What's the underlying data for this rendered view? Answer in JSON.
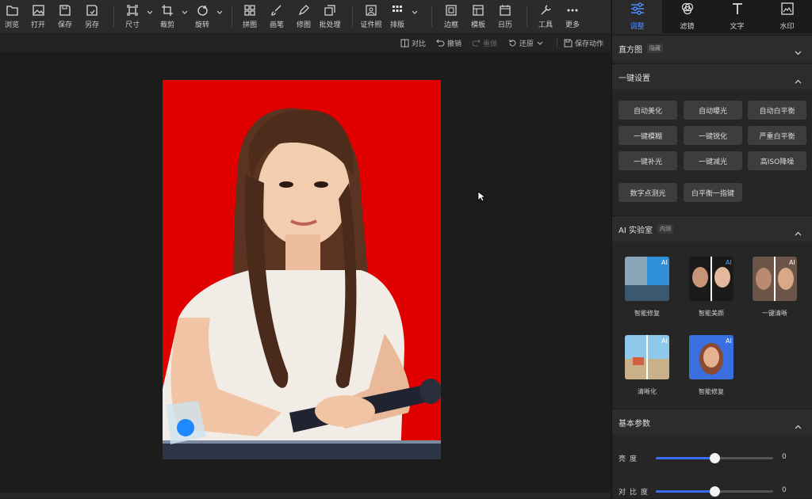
{
  "toolbar": {
    "new": "浏览",
    "open": "打开",
    "save": "保存",
    "save_as": "另存",
    "size": "尺寸",
    "crop": "裁剪",
    "rotate": "旋转",
    "collage": "拼图",
    "paint": "画笔",
    "retouch": "修图",
    "batch": "批处理",
    "id_photo": "证件照",
    "layout": "排版",
    "frame": "边框",
    "template": "模板",
    "calendar": "日历",
    "tools": "工具",
    "more": "更多"
  },
  "subbar": {
    "compare": "对比",
    "undo": "撤销",
    "redo": "重做",
    "restore": "还原",
    "save_action": "保存动作"
  },
  "panel": {
    "tabs": [
      {
        "label": "调整",
        "active": true
      },
      {
        "label": "滤镜",
        "active": false
      },
      {
        "label": "文字",
        "active": false
      },
      {
        "label": "水印",
        "active": false
      }
    ],
    "histogram": {
      "title": "直方图",
      "badge": "隐藏"
    },
    "one_click": {
      "title": "一键设置",
      "buttons": [
        "自动美化",
        "自动曝光",
        "自动白平衡",
        "一键模糊",
        "一键锐化",
        "严重白平衡",
        "一键补光",
        "一键减光",
        "高ISO降噪",
        "数字点测光",
        "白平衡一指键"
      ]
    },
    "ai_lab": {
      "title": "AI 实验室",
      "badge": "内测",
      "items": [
        "智能修复",
        "智能美颜",
        "一键清晰",
        "清晰化",
        "智能修复"
      ]
    },
    "basic": {
      "title": "基本参数",
      "sliders": [
        {
          "label": "亮度",
          "value": "0",
          "level": 0.5
        },
        {
          "label": "对比度",
          "value": "0",
          "level": 0.5
        }
      ]
    }
  },
  "colors": {
    "accent": "#3c6cf0",
    "photo_bg": "#e10000",
    "active_tab": "#4a8cff"
  }
}
